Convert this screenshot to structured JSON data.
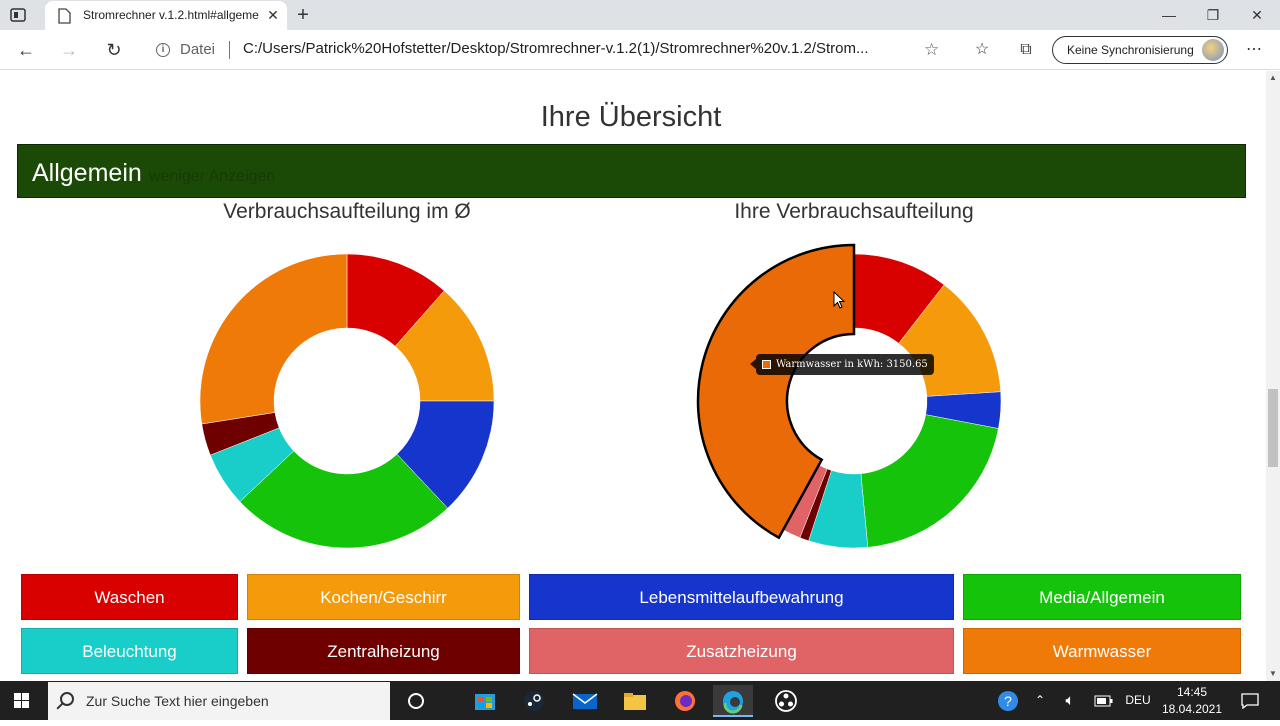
{
  "browser": {
    "tab_title": "Stromrechner v.1.2.html#allgeme",
    "new_tab": "+",
    "address_scheme": "Datei",
    "address_url": "C:/Users/Patrick%20Hofstetter/Desktop/Stromrechner-v.1.2(1)/Stromrechner%20v.1.2/Strom...",
    "sync_label": "Keine Synchronisierung"
  },
  "page": {
    "title": "Ihre Übersicht",
    "section_title": "Allgemein",
    "section_toggle": "weniger Anzeigen"
  },
  "chart_data": [
    {
      "type": "pie",
      "title": "Verbrauchsaufteilung im Ø",
      "donut": true,
      "categories": [
        "Waschen",
        "Kochen/Geschirr",
        "Lebensmittelaufbewahrung",
        "Media/Allgemein",
        "Beleuchtung",
        "Zentralheizung",
        "Zusatzheizung",
        "Warmwasser"
      ],
      "values": [
        11.5,
        13.5,
        13.0,
        25.0,
        6.0,
        3.5,
        0,
        27.5
      ],
      "colors": [
        "#d90000",
        "#f59a0a",
        "#1535cc",
        "#15c40a",
        "#19cdc8",
        "#6e0000",
        "#e06466",
        "#f07a08"
      ]
    },
    {
      "type": "pie",
      "title": "Ihre Verbrauchsaufteilung",
      "donut": true,
      "categories": [
        "Waschen",
        "Kochen/Geschirr",
        "Lebensmittelaufbewahrung",
        "Media/Allgemein",
        "Beleuchtung",
        "Zentralheizung",
        "Zusatzheizung",
        "Warmwasser"
      ],
      "values": [
        10.5,
        13.5,
        4.0,
        20.5,
        6.5,
        1.0,
        2.0,
        42.0
      ],
      "colors": [
        "#d90000",
        "#f59a0a",
        "#1535cc",
        "#15c40a",
        "#19cdc8",
        "#6e0000",
        "#e06466",
        "#e96a06"
      ],
      "highlighted": "Warmwasser",
      "tooltip": "Warmwasser in kWh: 3150.65"
    }
  ],
  "legend": [
    {
      "label": "Waschen",
      "color": "#d90000"
    },
    {
      "label": "Kochen/Geschirr",
      "color": "#f59a0a"
    },
    {
      "label": "Lebensmittelaufbewahrung",
      "color": "#1535cc"
    },
    {
      "label": "Media/Allgemein",
      "color": "#15c40a"
    },
    {
      "label": "Beleuchtung",
      "color": "#19cdc8"
    },
    {
      "label": "Zentralheizung",
      "color": "#6e0000"
    },
    {
      "label": "Zusatzheizung",
      "color": "#e06466"
    },
    {
      "label": "Warmwasser",
      "color": "#f07a08"
    }
  ],
  "taskbar": {
    "search_placeholder": "Zur Suche Text hier eingeben",
    "language": "DEU",
    "time": "14:45",
    "date": "18.04.2021"
  }
}
